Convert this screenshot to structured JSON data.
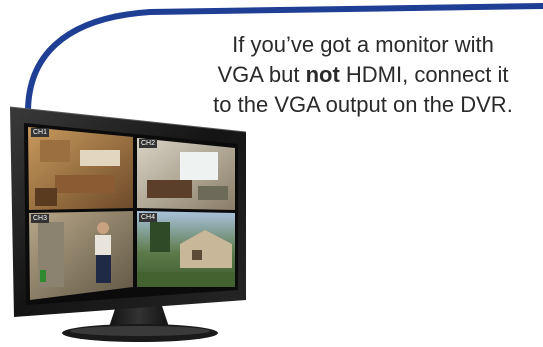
{
  "caption": {
    "line1": "If you’ve got a monitor with",
    "line2_pre": "VGA but ",
    "line2_bold": "not",
    "line2_post": " HDMI, connect it",
    "line3": "to the VGA output on the DVR."
  },
  "cameras": [
    {
      "label": "CH1"
    },
    {
      "label": "CH2"
    },
    {
      "label": "CH3"
    },
    {
      "label": "CH4"
    }
  ],
  "colors": {
    "cable": "#1f3f94",
    "bezel": "#1c1c1c",
    "text": "#2a2a2a"
  }
}
